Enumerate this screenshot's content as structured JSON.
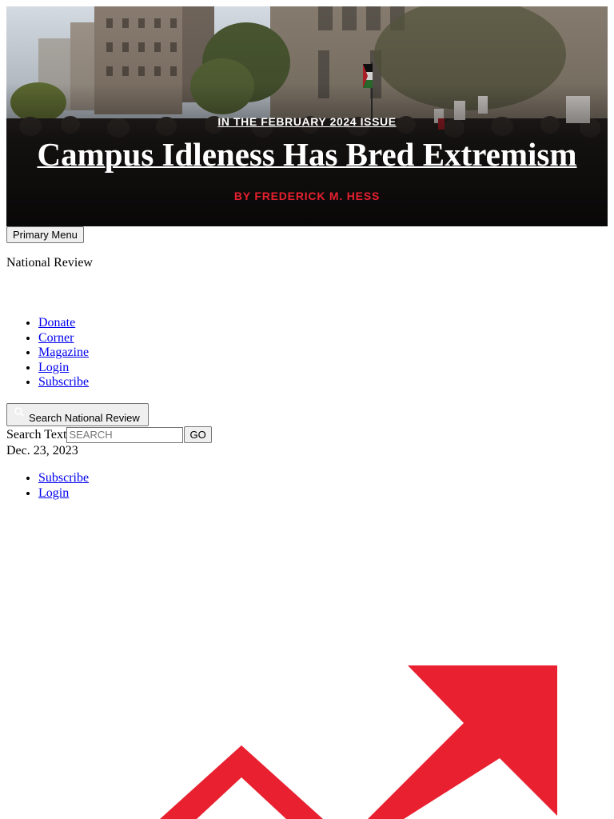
{
  "hero": {
    "kicker": "IN THE FEBRUARY 2024 ISSUE",
    "headline": "Campus Idleness Has Bred Extremism",
    "byline": "BY FREDERICK M. HESS",
    "colors": {
      "byline": "#e8202f",
      "text": "#ffffff"
    }
  },
  "header": {
    "menu_button": "Primary Menu",
    "site_name": "National Review"
  },
  "nav": {
    "items": [
      {
        "label": "Donate"
      },
      {
        "label": "Corner"
      },
      {
        "label": "Magazine"
      },
      {
        "label": "Login"
      },
      {
        "label": "Subscribe"
      }
    ]
  },
  "search": {
    "toggle_label": "Search National Review",
    "icon": "search-icon",
    "field_label": "Search Text",
    "placeholder": "SEARCH",
    "submit_label": "GO"
  },
  "date": "Dec. 23, 2023",
  "utility": {
    "items": [
      {
        "label": "Subscribe"
      },
      {
        "label": "Login"
      }
    ]
  },
  "logo": {
    "icon": "national-review-logo-arrows",
    "color": "#e8202f"
  }
}
